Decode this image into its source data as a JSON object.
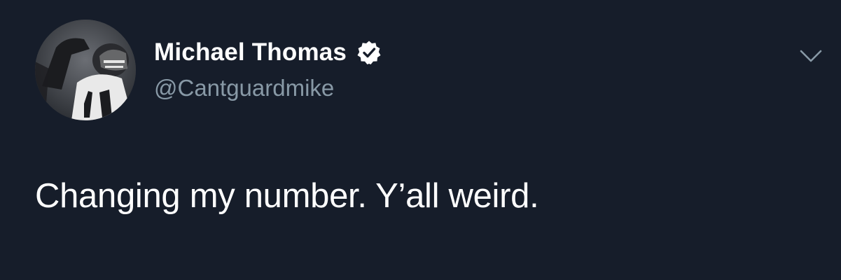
{
  "author": {
    "display_name": "Michael Thomas",
    "handle": "@Cantguardmike",
    "verified": true,
    "avatar_icon": "football-player-avatar"
  },
  "tweet": {
    "text": "Changing my number. Y’all weird."
  },
  "menu": {
    "icon": "chevron-down-icon"
  },
  "colors": {
    "background": "#161d2a",
    "text": "#ffffff",
    "secondary_text": "#8899a6"
  }
}
